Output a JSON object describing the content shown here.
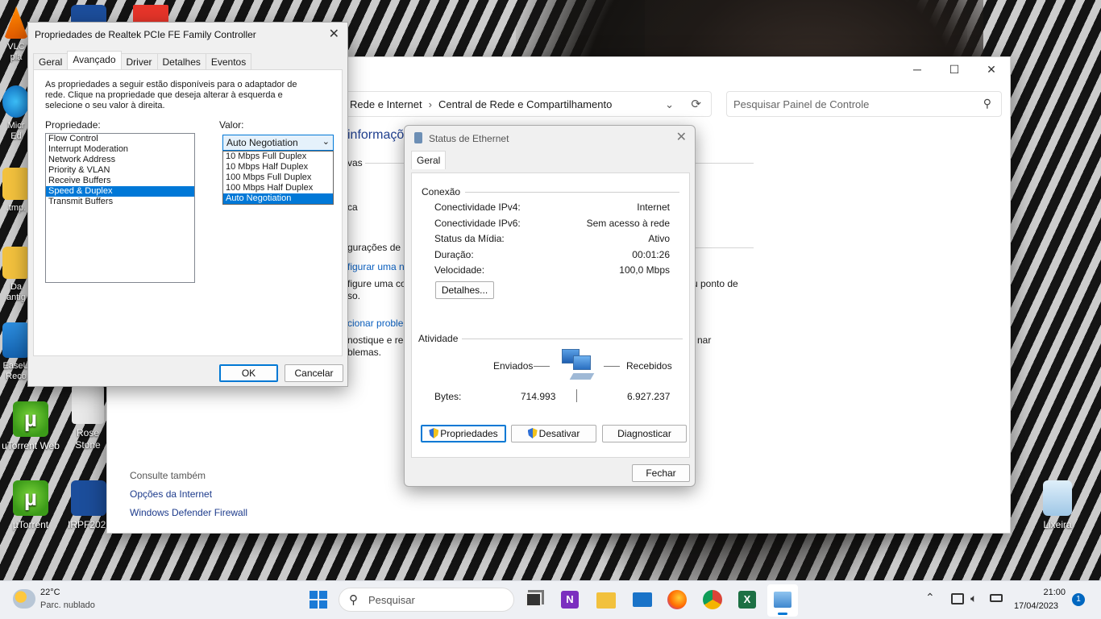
{
  "desktop": {
    "icons": [
      {
        "label": "VLC\nplay",
        "x": 0
      },
      {
        "label": "Micr\nEd",
        "x": 0
      },
      {
        "label": ".tmp.",
        "x": 0
      },
      {
        "label": "Da\nantig",
        "x": 0
      },
      {
        "label": "EaseU\nReco",
        "x": 0
      },
      {
        "label": "uTorrent Web"
      },
      {
        "label": "Rose\nStone"
      },
      {
        "label": "µTorrent"
      },
      {
        "label": "IRPF2023"
      },
      {
        "label": "Lixeira"
      }
    ]
  },
  "control_panel": {
    "breadcrumb": [
      "Rede e Internet",
      "Central de Rede e Compartilhamento"
    ],
    "search_placeholder": "Pesquisar Painel de Controle",
    "heading_partial": "informaçõ",
    "bg_texts": [
      "vas",
      "ca",
      "gurações de r",
      "figurar uma n",
      "figure uma co",
      "so.",
      "u ponto de",
      "cionar proble",
      "nostique e rep",
      "nar",
      "blemas."
    ],
    "see_also_label": "Consulte também",
    "see_also_links": [
      "Opções da Internet",
      "Windows Defender Firewall"
    ]
  },
  "realtek_dialog": {
    "title": "Propriedades de Realtek PCIe FE Family Controller",
    "tabs": [
      "Geral",
      "Avançado",
      "Driver",
      "Detalhes",
      "Eventos"
    ],
    "active_tab": "Avançado",
    "description": "As propriedades a seguir estão disponíveis para o adaptador de rede. Clique na propriedade que deseja alterar à esquerda e selecione o seu valor à direita.",
    "property_label": "Propriedade:",
    "value_label": "Valor:",
    "properties": [
      "Flow Control",
      "Interrupt Moderation",
      "Network Address",
      "Priority & VLAN",
      "Receive Buffers",
      "Speed & Duplex",
      "Transmit Buffers"
    ],
    "selected_property": "Speed & Duplex",
    "combo_value": "Auto Negotiation",
    "options": [
      "10 Mbps Full Duplex",
      "10 Mbps Half Duplex",
      "100 Mbps Full Duplex",
      "100 Mbps Half Duplex",
      "Auto Negotiation"
    ],
    "selected_option": "Auto Negotiation",
    "ok_label": "OK",
    "cancel_label": "Cancelar"
  },
  "ethernet_status": {
    "title": "Status de Ethernet",
    "tab": "Geral",
    "connection_label": "Conexão",
    "rows": [
      {
        "label": "Conectividade IPv4:",
        "value": "Internet"
      },
      {
        "label": "Conectividade IPv6:",
        "value": "Sem acesso à rede"
      },
      {
        "label": "Status da Mídia:",
        "value": "Ativo"
      },
      {
        "label": "Duração:",
        "value": "00:01:26"
      },
      {
        "label": "Velocidade:",
        "value": "100,0 Mbps"
      }
    ],
    "details_label": "Detalhes...",
    "activity_label": "Atividade",
    "sent_label": "Enviados",
    "received_label": "Recebidos",
    "bytes_label": "Bytes:",
    "bytes_sent": "714.993",
    "bytes_received": "6.927.237",
    "properties_label": "Propriedades",
    "disable_label": "Desativar",
    "diagnose_label": "Diagnosticar",
    "close_label": "Fechar"
  },
  "taskbar": {
    "weather_temp": "22°C",
    "weather_desc": "Parc. nublado",
    "search_label": "Pesquisar",
    "time": "21:00",
    "date": "17/04/2023",
    "notification_count": "1"
  }
}
